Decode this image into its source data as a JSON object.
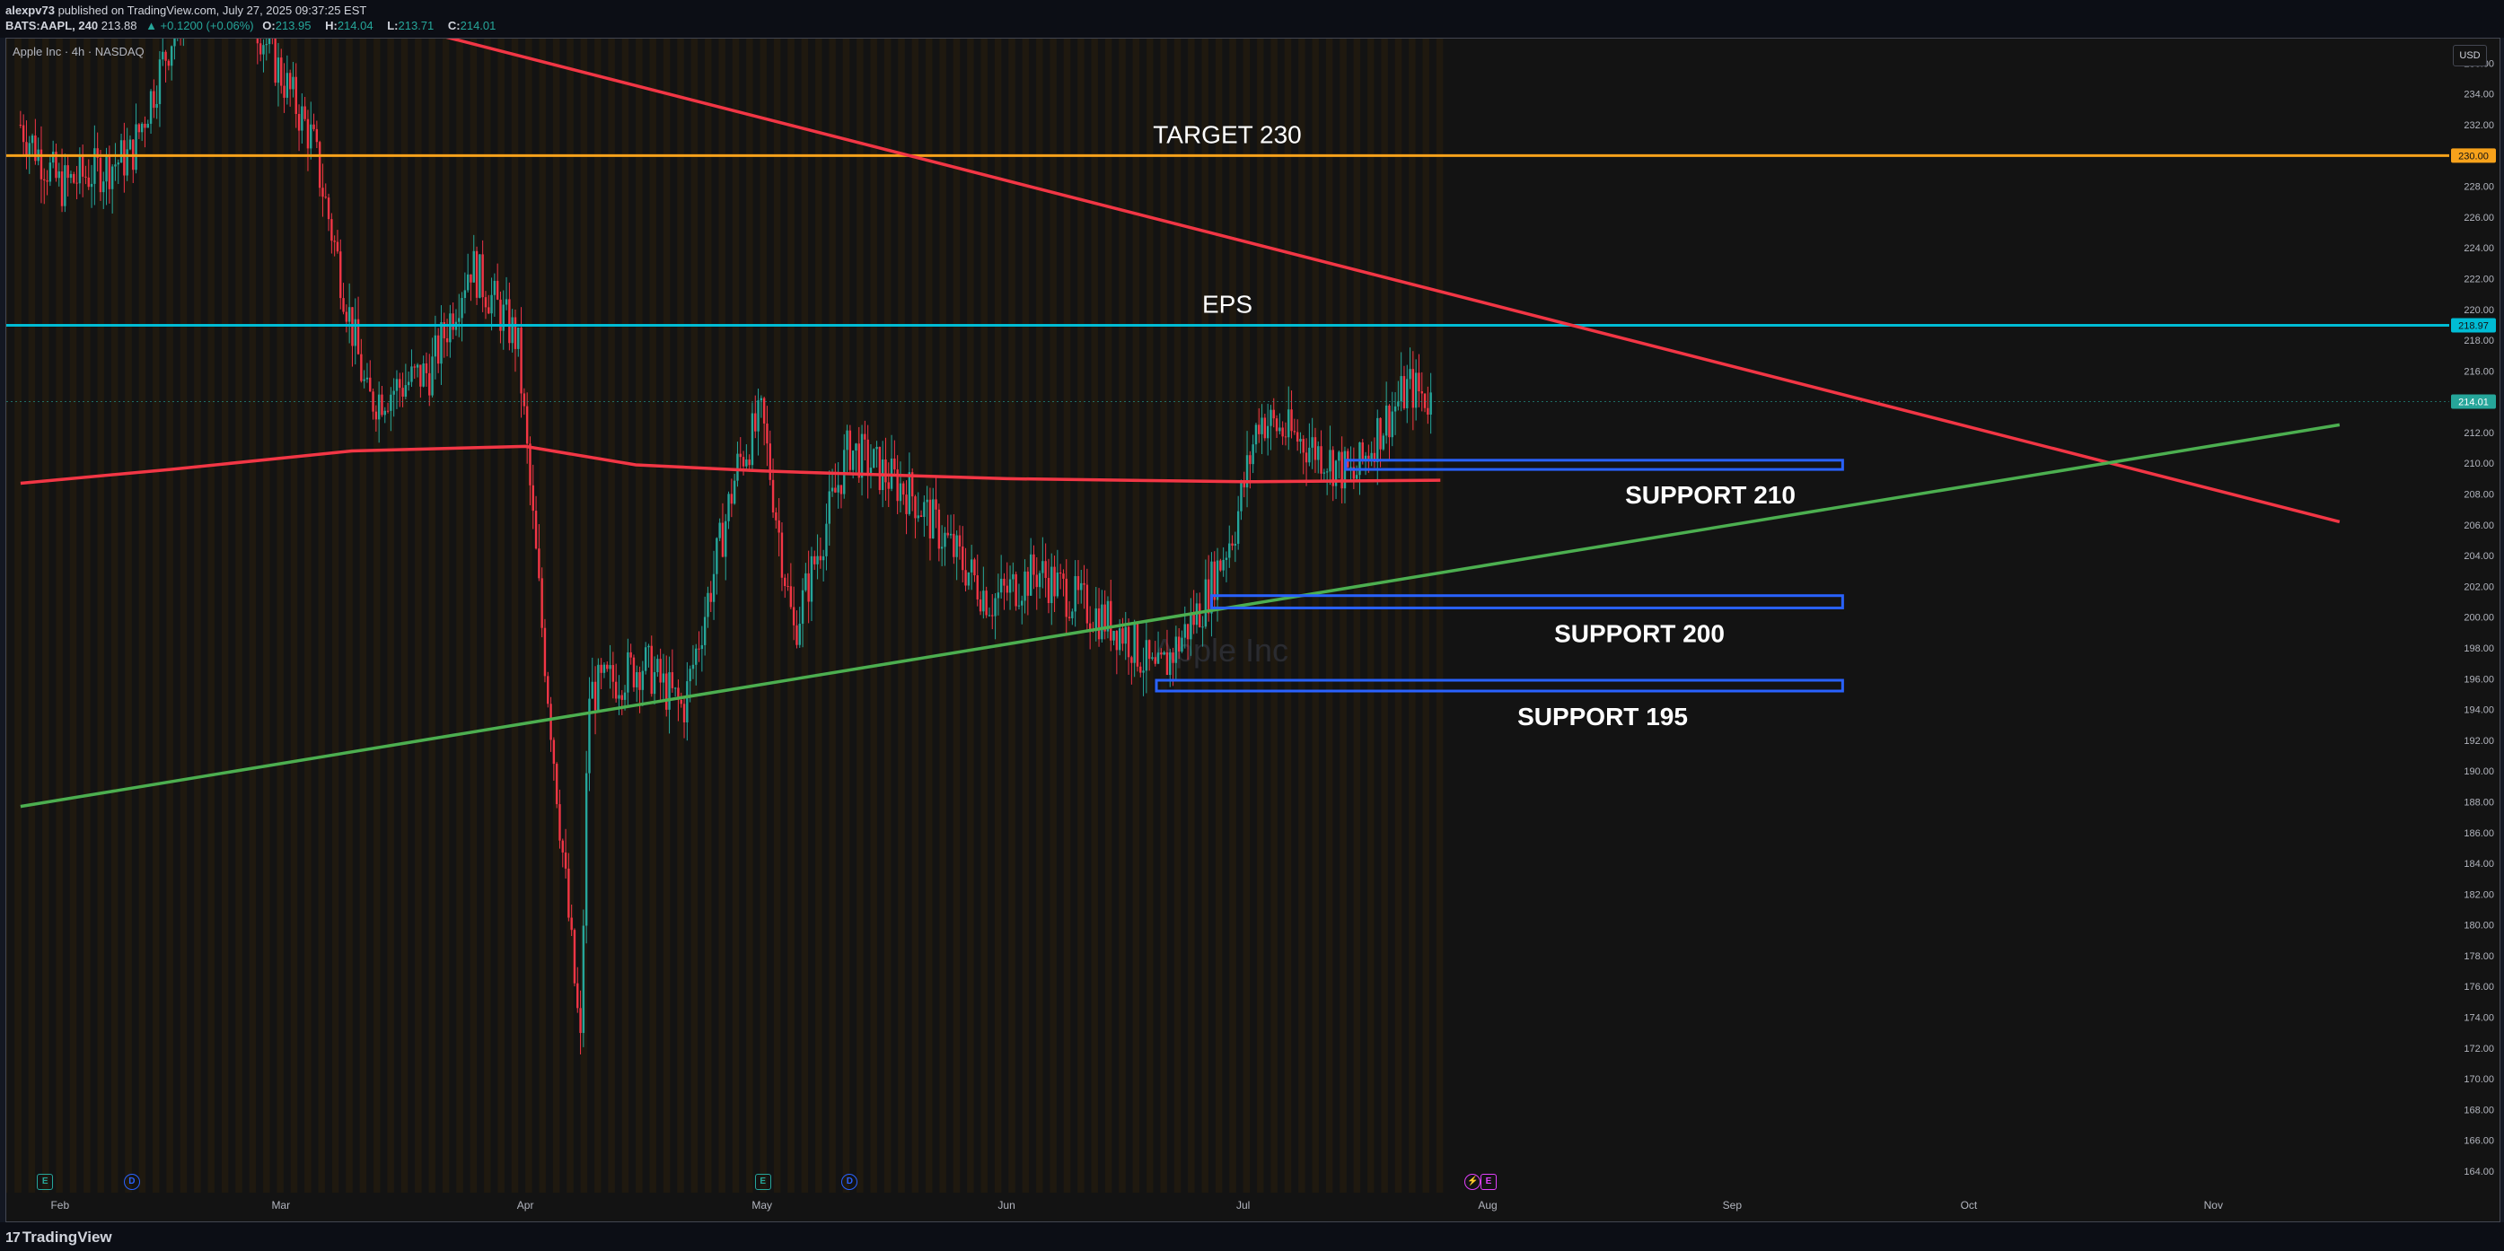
{
  "header": {
    "author": "alexpv73",
    "published": "published on TradingView.com, July 27, 2025 09:37:25 EST",
    "symbol": "BATS:AAPL, 240",
    "price": "213.88",
    "change": "▲ +0.1200 (+0.06%)",
    "ohlc_open_label": "O:",
    "ohlc_open": "213.95",
    "ohlc_high_label": "H:",
    "ohlc_high": "214.04",
    "ohlc_low_label": "L:",
    "ohlc_low": "213.71",
    "ohlc_close_label": "C:",
    "ohlc_close": "214.01"
  },
  "symbol_title": "Apple Inc · 4h · NASDAQ",
  "currency": "USD",
  "watermark": "Apple Inc",
  "footer": {
    "logo_mark": "17",
    "logo_text": "TradingView"
  },
  "colors": {
    "bull": "#26a69a",
    "bear": "#f23645",
    "target": "#f7a21b",
    "eps": "#00bcd4",
    "resistance": "#f23645",
    "support_line": "#4caf50",
    "ma": "#f23645",
    "support_box": "#2962ff"
  },
  "event_badges": [
    {
      "type": "E",
      "icon": "earnings-icon",
      "color": "#26a69a"
    },
    {
      "type": "D",
      "icon": "dividend-icon",
      "color": "#2962ff"
    },
    {
      "type": "E",
      "icon": "earnings-icon",
      "color": "#26a69a"
    },
    {
      "type": "D",
      "icon": "dividend-icon",
      "color": "#2962ff"
    },
    {
      "type": "⚡",
      "icon": "split-icon",
      "color": "#e040fb"
    },
    {
      "type": "E",
      "icon": "earnings-icon",
      "color": "#e040fb"
    }
  ],
  "chart_data": {
    "type": "candlestick",
    "title": "Apple Inc · 4h · NASDAQ",
    "x_labels": [
      "Feb",
      "Mar",
      "Apr",
      "May",
      "Jun",
      "Jul",
      "Aug",
      "Sep",
      "Oct",
      "Nov"
    ],
    "y_ticks": [
      "236.00",
      "234.00",
      "232.00",
      "230.00",
      "228.00",
      "226.00",
      "224.00",
      "222.00",
      "220.00",
      "218.00",
      "216.00",
      "214.00",
      "212.00",
      "210.00",
      "208.00",
      "206.00",
      "204.00",
      "202.00",
      "200.00",
      "198.00",
      "196.00",
      "194.00",
      "192.00",
      "190.00",
      "188.00",
      "186.00",
      "184.00",
      "182.00",
      "180.00",
      "178.00",
      "176.00",
      "174.00",
      "172.00",
      "170.00",
      "168.00",
      "166.00",
      "164.00"
    ],
    "ylim": [
      162.6,
      237.6
    ],
    "price_path": [
      [
        "2025-01-27",
        232
      ],
      [
        "2025-02-01",
        228
      ],
      [
        "2025-02-10",
        230
      ],
      [
        "2025-02-20",
        245
      ],
      [
        "2025-03-05",
        231
      ],
      [
        "2025-03-12",
        214
      ],
      [
        "2025-03-20",
        216
      ],
      [
        "2025-03-25",
        223
      ],
      [
        "2025-03-31",
        218
      ],
      [
        "2025-04-03",
        200
      ],
      [
        "2025-04-08",
        172
      ],
      [
        "2025-04-09",
        195
      ],
      [
        "2025-04-16",
        197
      ],
      [
        "2025-04-21",
        194
      ],
      [
        "2025-04-28",
        210
      ],
      [
        "2025-05-01",
        213
      ],
      [
        "2025-05-05",
        199
      ],
      [
        "2025-05-12",
        211
      ],
      [
        "2025-05-20",
        208
      ],
      [
        "2025-05-30",
        201
      ],
      [
        "2025-06-05",
        203
      ],
      [
        "2025-06-10",
        201
      ],
      [
        "2025-06-16",
        199
      ],
      [
        "2025-06-20",
        196
      ],
      [
        "2025-06-26",
        201
      ],
      [
        "2025-06-30",
        206
      ],
      [
        "2025-07-03",
        213
      ],
      [
        "2025-07-10",
        211
      ],
      [
        "2025-07-15",
        209
      ],
      [
        "2025-07-18",
        212
      ],
      [
        "2025-07-22",
        215
      ],
      [
        "2025-07-25",
        214.01
      ]
    ],
    "last_price": "214.01",
    "horizontal_lines": [
      {
        "name": "TARGET 230",
        "price": 230.0,
        "price_label": "230.00"
      },
      {
        "name": "EPS",
        "price": 218.97,
        "price_label": "218.97"
      }
    ],
    "trend_lines": [
      {
        "role": "resistance",
        "from": [
          "2025-03-09",
          239.4
        ],
        "to": [
          "2025-11-17",
          206.2
        ]
      },
      {
        "role": "support",
        "from": [
          "2025-01-27",
          187.7
        ],
        "to": [
          "2025-11-17",
          212.5
        ]
      }
    ],
    "moving_average": [
      [
        "2025-01-27",
        208.7
      ],
      [
        "2025-02-15",
        209.6
      ],
      [
        "2025-03-10",
        210.8
      ],
      [
        "2025-04-01",
        211.1
      ],
      [
        "2025-04-15",
        209.9
      ],
      [
        "2025-05-01",
        209.5
      ],
      [
        "2025-06-01",
        209.0
      ],
      [
        "2025-07-01",
        208.8
      ],
      [
        "2025-07-26",
        208.9
      ]
    ],
    "support_zones": [
      {
        "label": "SUPPORT 210",
        "from": "2025-07-14",
        "to": "2025-09-15",
        "low": 209.6,
        "high": 210.2
      },
      {
        "label": "SUPPORT 200",
        "from": "2025-06-27",
        "to": "2025-09-15",
        "low": 200.6,
        "high": 201.4
      },
      {
        "label": "SUPPORT 195",
        "from": "2025-06-20",
        "to": "2025-09-15",
        "low": 195.2,
        "high": 195.9
      }
    ]
  }
}
